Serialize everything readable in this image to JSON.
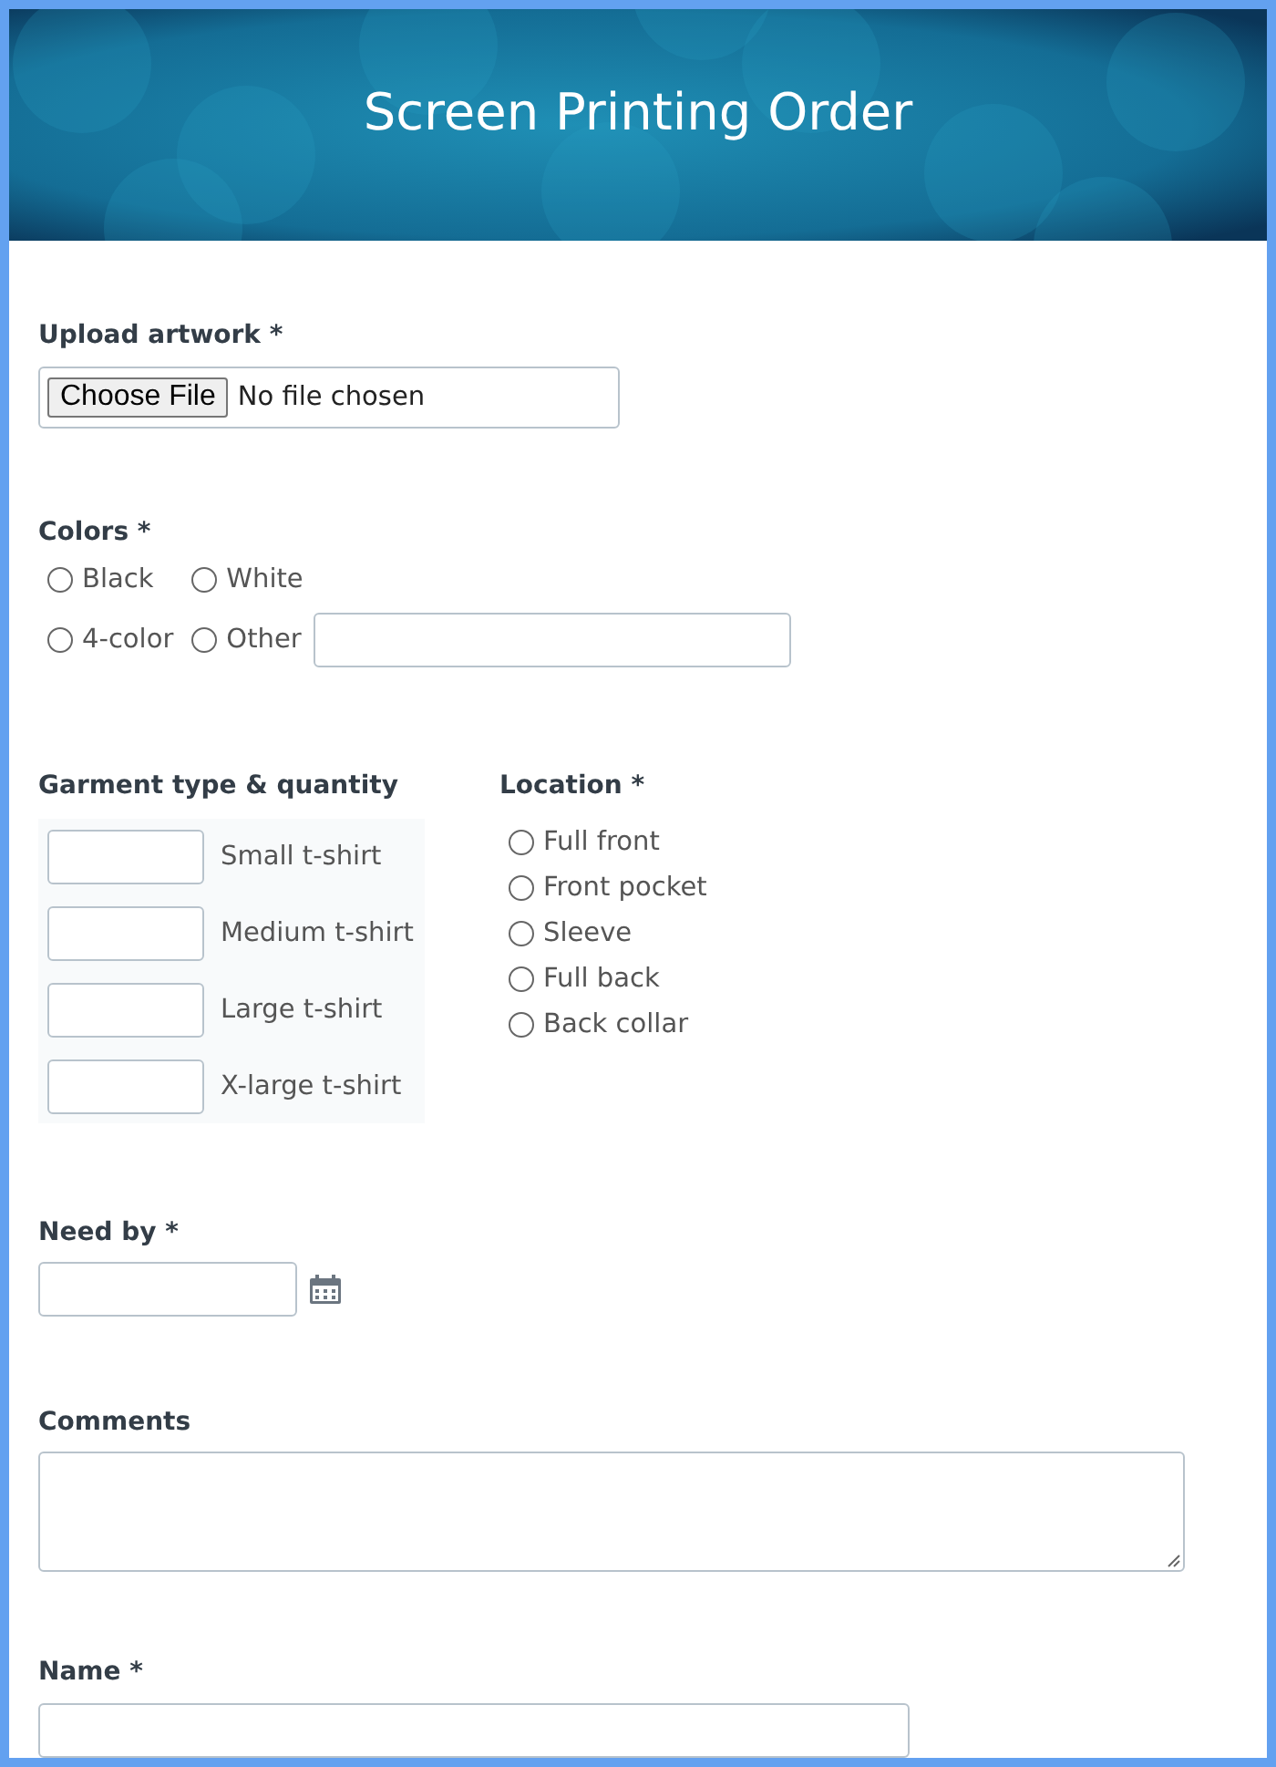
{
  "header": {
    "title": "Screen Printing Order"
  },
  "upload": {
    "label": "Upload artwork *",
    "button": "Choose File",
    "status": "No file chosen"
  },
  "colors": {
    "label": "Colors *",
    "options": [
      {
        "label": "Black",
        "selected": false
      },
      {
        "label": "White",
        "selected": false
      },
      {
        "label": "4-color",
        "selected": false
      },
      {
        "label": "Other",
        "selected": false,
        "kind": "other"
      }
    ]
  },
  "garment": {
    "label": "Garment type & quantity",
    "items": [
      {
        "label": "Small t-shirt"
      },
      {
        "label": "Medium t-shirt"
      },
      {
        "label": "Large t-shirt"
      },
      {
        "label": "X-large t-shirt"
      }
    ]
  },
  "location": {
    "label": "Location *",
    "options": [
      {
        "label": "Full front",
        "selected": false
      },
      {
        "label": "Front pocket",
        "selected": false
      },
      {
        "label": "Sleeve",
        "selected": false
      },
      {
        "label": "Full back",
        "selected": false
      },
      {
        "label": "Back collar",
        "selected": false
      }
    ]
  },
  "need_by": {
    "label": "Need by *"
  },
  "comments": {
    "label": "Comments"
  },
  "name": {
    "label": "Name *"
  }
}
